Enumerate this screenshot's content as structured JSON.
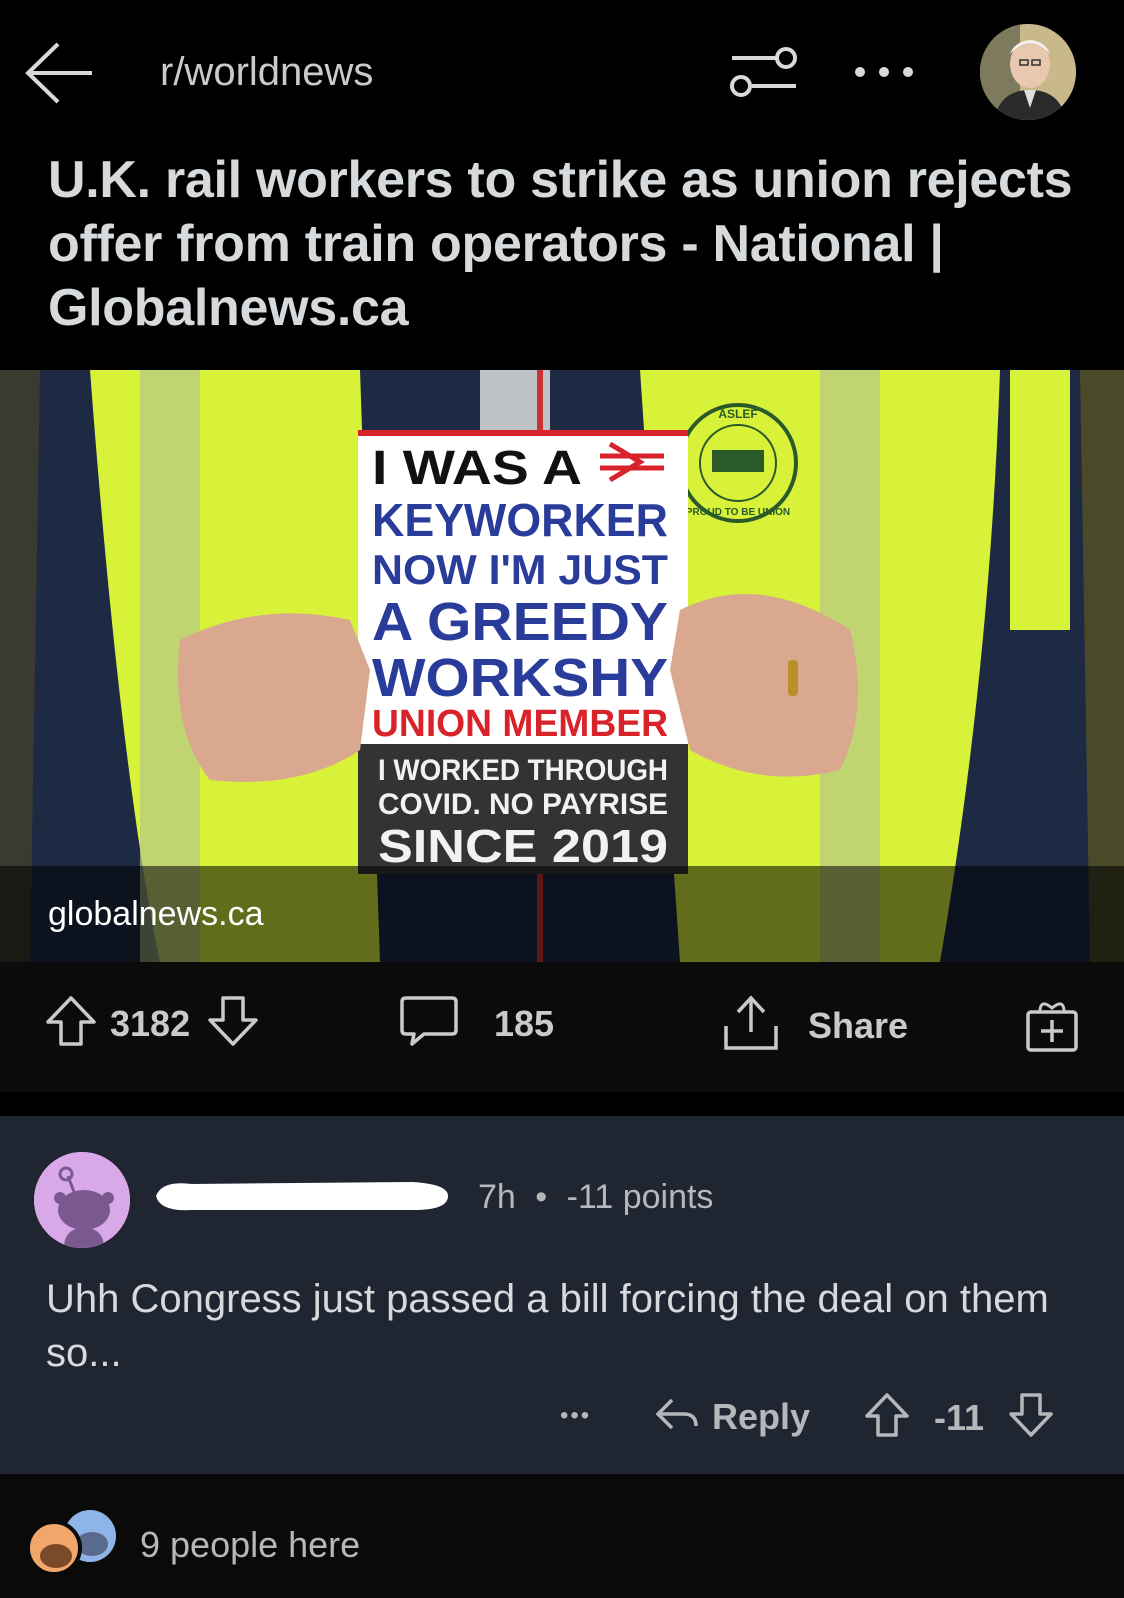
{
  "header": {
    "subreddit": "r/worldnews"
  },
  "post": {
    "title": "U.K. rail workers to strike as union rejects offer from train operators - National | Globalnews.ca",
    "link_domain": "globalnews.ca",
    "image_sign": {
      "line1": "I WAS A",
      "line2": "KEYWORKER",
      "line3": "NOW I'M JUST",
      "line4": "A GREEDY",
      "line5": "WORKSHY",
      "line6": "UNION MEMBER",
      "line7": "I WORKED THROUGH",
      "line8": "COVID. NO PAYRISE",
      "line9": "SINCE 2019",
      "badge_top": "ASLEF",
      "badge_bottom": "PROUD TO BE UNION"
    },
    "upvotes": "3182",
    "comments": "185",
    "share_label": "Share"
  },
  "comment": {
    "time": "7h",
    "separator": "•",
    "points": "-11 points",
    "body": "Uhh Congress just passed a bill forcing the deal on them so...",
    "reply_label": "Reply",
    "score": "-11",
    "more": "•••"
  },
  "footer": {
    "people_here": "9 people here"
  },
  "colors": {
    "background": "#000000",
    "comment_bg": "#1f2631",
    "text": "#d7dadc",
    "muted": "#b5b8bb",
    "sign_blue": "#2a3c9a",
    "sign_red": "#d8232a",
    "vest_yellow": "#d8f23a"
  }
}
